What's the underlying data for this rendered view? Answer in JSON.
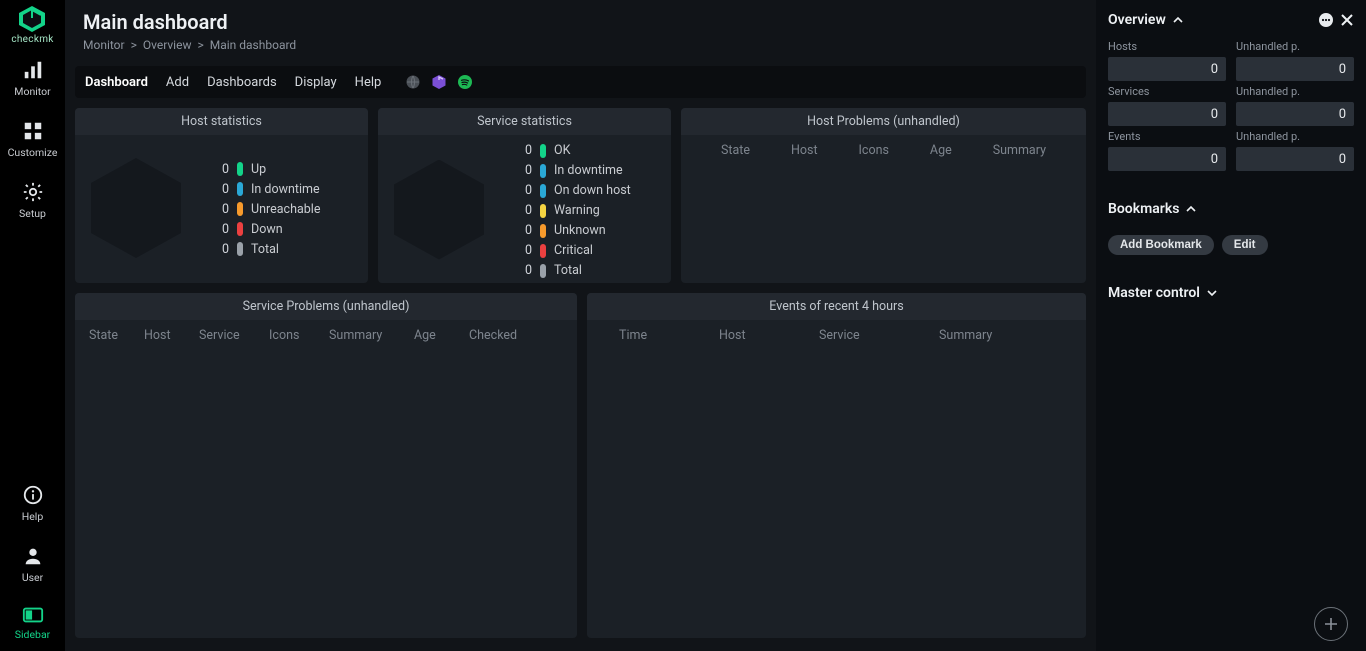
{
  "brand": {
    "name": "checkmk"
  },
  "left_nav": {
    "monitor": "Monitor",
    "customize": "Customize",
    "setup": "Setup",
    "help": "Help",
    "user": "User",
    "sidebar": "Sidebar"
  },
  "page": {
    "title": "Main dashboard",
    "breadcrumb": {
      "a": "Monitor",
      "b": "Overview",
      "c": "Main dashboard",
      "sep": ">"
    }
  },
  "menubar": {
    "dashboard": "Dashboard",
    "add": "Add",
    "dashboards": "Dashboards",
    "display": "Display",
    "help": "Help"
  },
  "dashlets": {
    "host_stats_title": "Host statistics",
    "service_stats_title": "Service statistics",
    "host_problems_title": "Host Problems (unhandled)",
    "service_problems_title": "Service Problems (unhandled)",
    "events_recent_title": "Events of recent 4 hours"
  },
  "host_stats": {
    "up": {
      "n": "0",
      "label": "Up"
    },
    "dt": {
      "n": "0",
      "label": "In downtime"
    },
    "unr": {
      "n": "0",
      "label": "Unreachable"
    },
    "down": {
      "n": "0",
      "label": "Down"
    },
    "total": {
      "n": "0",
      "label": "Total"
    }
  },
  "service_stats": {
    "ok": {
      "n": "0",
      "label": "OK"
    },
    "dt": {
      "n": "0",
      "label": "In downtime"
    },
    "ondown": {
      "n": "0",
      "label": "On down host"
    },
    "warn": {
      "n": "0",
      "label": "Warning"
    },
    "unk": {
      "n": "0",
      "label": "Unknown"
    },
    "crit": {
      "n": "0",
      "label": "Critical"
    },
    "total": {
      "n": "0",
      "label": "Total"
    }
  },
  "host_problems_cols": {
    "state": "State",
    "host": "Host",
    "icons": "Icons",
    "age": "Age",
    "summary": "Summary"
  },
  "service_problems_cols": {
    "state": "State",
    "host": "Host",
    "service": "Service",
    "icons": "Icons",
    "summary": "Summary",
    "age": "Age",
    "checked": "Checked"
  },
  "events_cols": {
    "time": "Time",
    "host": "Host",
    "service": "Service",
    "summary": "Summary"
  },
  "overview": {
    "title": "Overview",
    "hosts_label": "Hosts",
    "hosts_value": "0",
    "hosts_unhandled_label": "Unhandled p.",
    "hosts_unhandled_value": "0",
    "services_label": "Services",
    "services_value": "0",
    "services_unhandled_label": "Unhandled p.",
    "services_unhandled_value": "0",
    "events_label": "Events",
    "events_value": "0",
    "events_unhandled_label": "Unhandled p.",
    "events_unhandled_value": "0"
  },
  "bookmarks": {
    "title": "Bookmarks",
    "add": "Add Bookmark",
    "edit": "Edit"
  },
  "master_control": {
    "title": "Master control"
  },
  "colors": {
    "accent": "#13d389",
    "warn": "#f5d442",
    "crit": "#eb4040",
    "unknown": "#f79a2c",
    "downtime": "#2aa8d6"
  }
}
